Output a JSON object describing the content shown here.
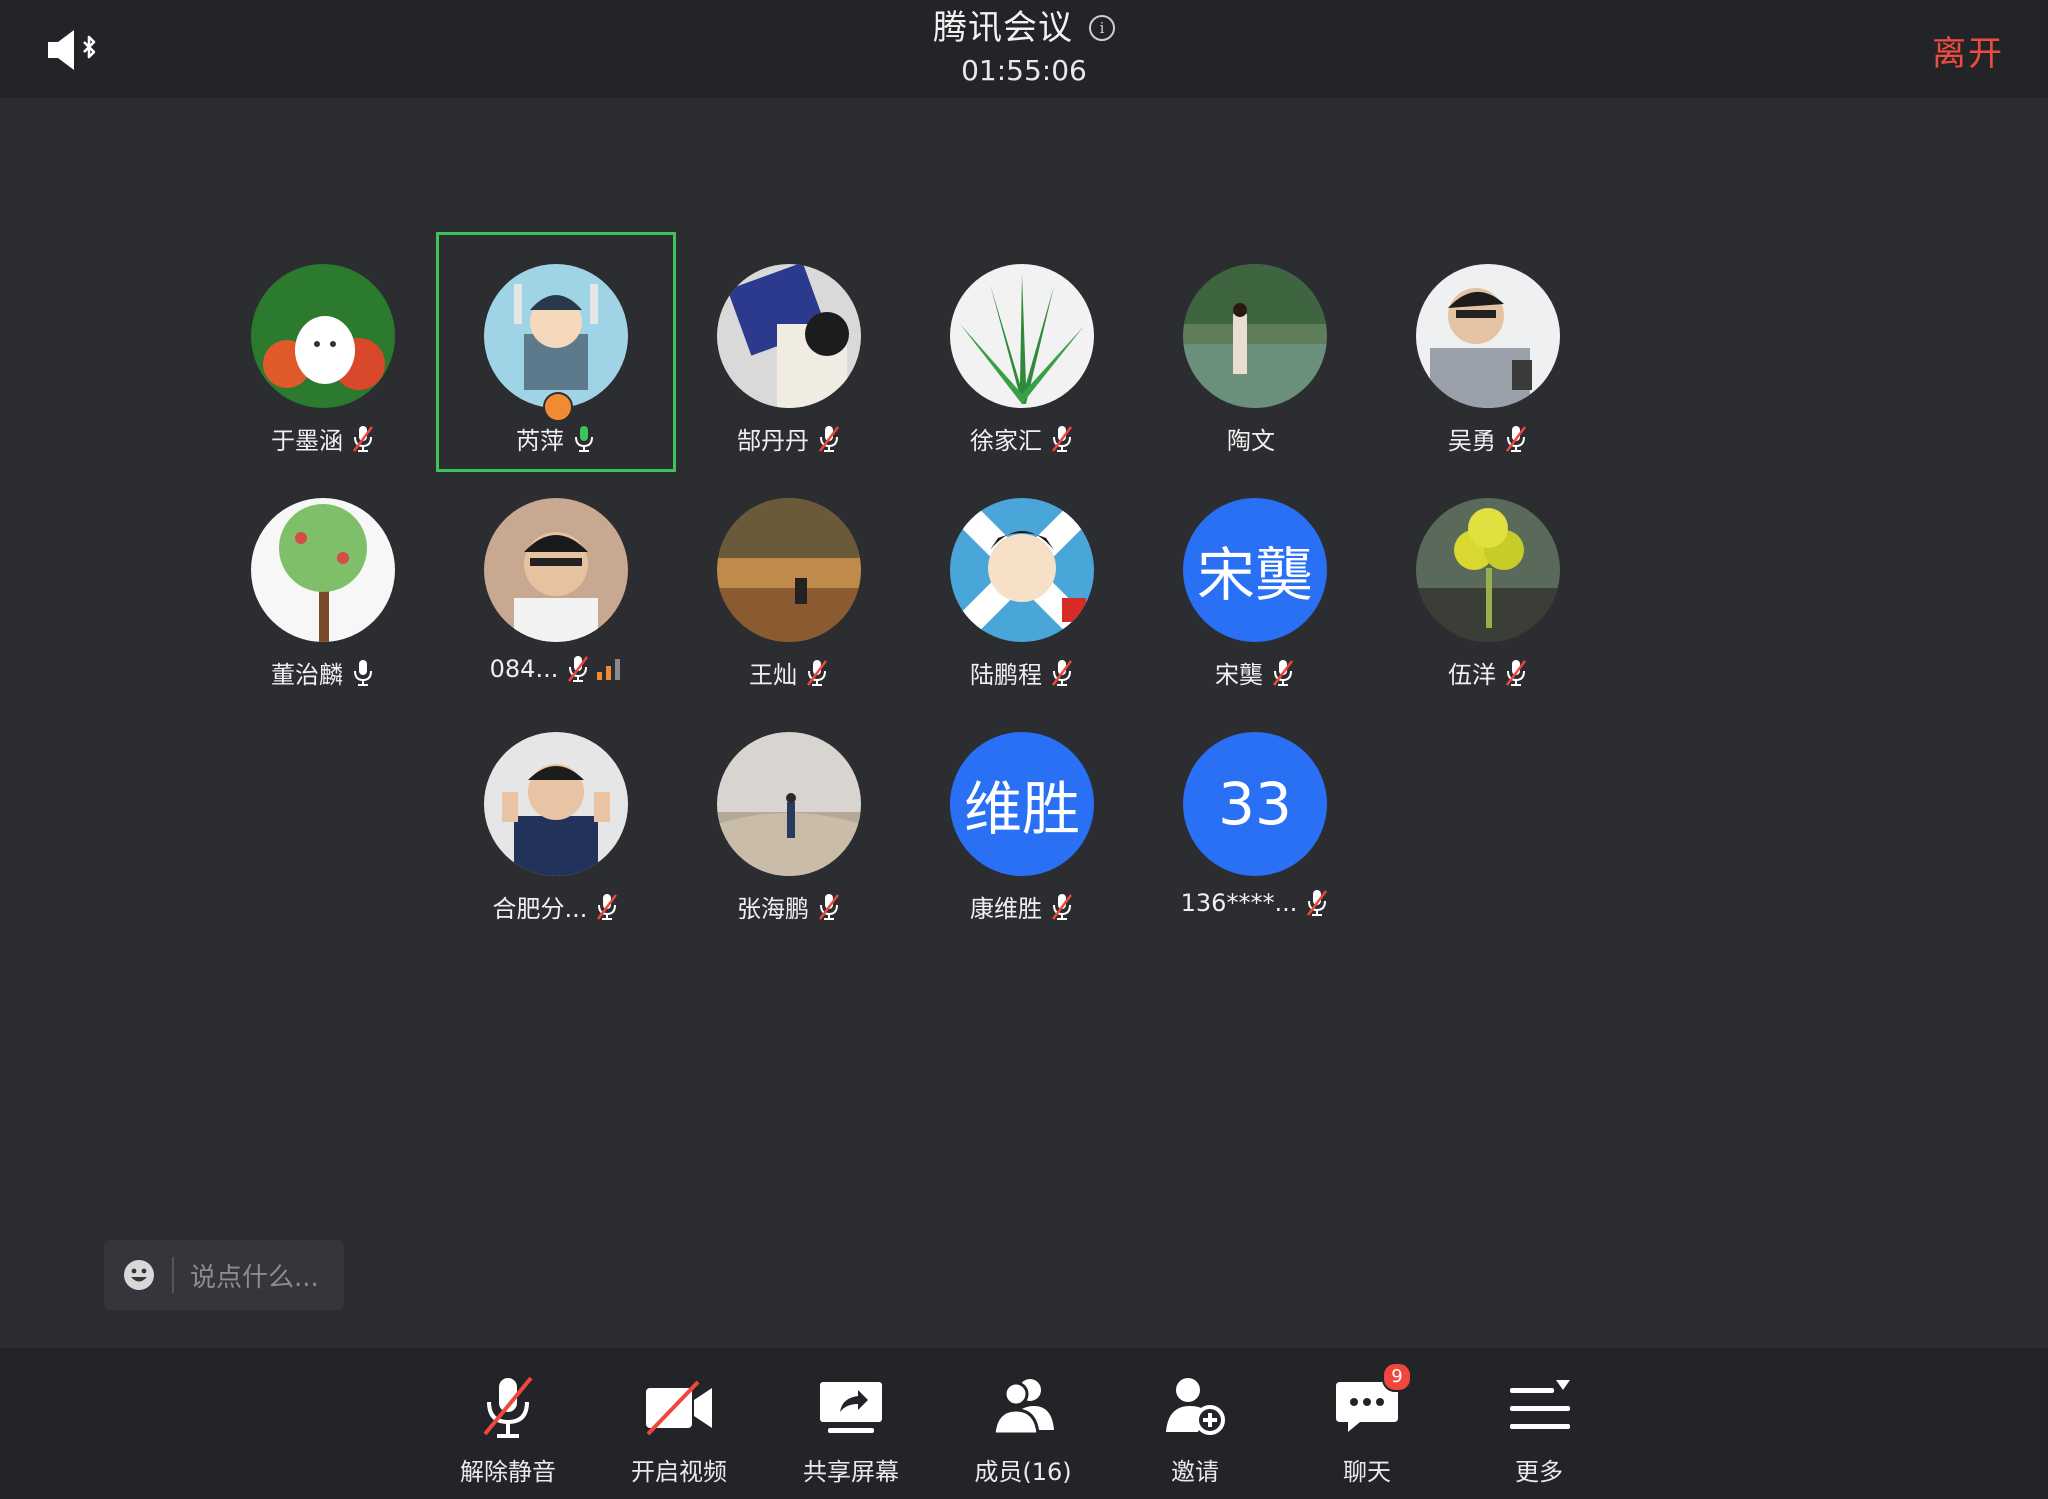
{
  "header": {
    "title": "腾讯会议",
    "timer": "01:55:06",
    "leave_label": "离开"
  },
  "participants": [
    {
      "name": "于墨涵",
      "mic": "muted"
    },
    {
      "name": "芮萍",
      "mic": "active",
      "host": true
    },
    {
      "name": "郜丹丹",
      "mic": "muted"
    },
    {
      "name": "徐家汇",
      "mic": "muted"
    },
    {
      "name": "陶文",
      "mic": "none"
    },
    {
      "name": "吴勇",
      "mic": "muted"
    },
    {
      "name": "董治麟",
      "mic": "on"
    },
    {
      "name": "084...",
      "mic": "muted",
      "signal": true
    },
    {
      "name": "王灿",
      "mic": "muted"
    },
    {
      "name": "陆鹏程",
      "mic": "muted"
    },
    {
      "name": "宋龑",
      "mic": "muted",
      "avatar_text": "宋龑"
    },
    {
      "name": "伍洋",
      "mic": "muted"
    },
    {
      "name": "合肥分...",
      "mic": "muted"
    },
    {
      "name": "张海鹏",
      "mic": "muted"
    },
    {
      "name": "康维胜",
      "mic": "muted",
      "avatar_text": "维胜"
    },
    {
      "name": "136****...",
      "mic": "muted",
      "avatar_text": "33"
    }
  ],
  "chat_input": {
    "placeholder": "说点什么..."
  },
  "toolbar": {
    "unmute_label": "解除静音",
    "video_label": "开启视频",
    "share_label": "共享屏幕",
    "members_label": "成员(16)",
    "invite_label": "邀请",
    "chat_label": "聊天",
    "chat_badge": "9",
    "more_label": "更多"
  },
  "colors": {
    "background": "#2c2d31",
    "bar": "#232428",
    "leave": "#f04b42",
    "active_speaker": "#3ec25b",
    "avatar_blue": "#2970f5",
    "badge": "#f0473d"
  }
}
